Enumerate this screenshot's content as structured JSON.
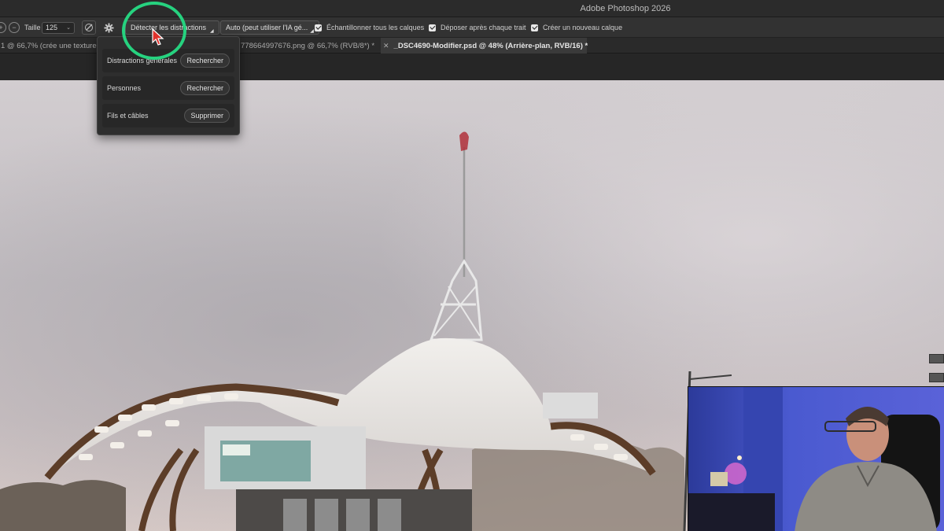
{
  "app": {
    "title": "Adobe Photoshop 2026"
  },
  "options_bar": {
    "size_label": "Taille",
    "size_value": "125",
    "detect_button": "Détecter les distractions",
    "mode_select": "Auto (peut utiliser l'IA gé...",
    "checkboxes": [
      {
        "label": "Échantillonner tous les calques",
        "checked": true
      },
      {
        "label": "Déposer après chaque trait",
        "checked": true
      },
      {
        "label": "Créer un nouveau calque",
        "checked": true
      }
    ]
  },
  "tabs": [
    {
      "label": "1 @ 66,7% (crée une texture",
      "active": false
    },
    {
      "label": "778664997676.png @ 66,7% (RVB/8*) *",
      "active": false
    },
    {
      "label": "_DSC4690-Modifier.psd @ 48% (Arrière-plan, RVB/16) *",
      "active": true
    }
  ],
  "detect_menu": {
    "items": [
      {
        "label": "Distractions générales",
        "action": "Rechercher"
      },
      {
        "label": "Personnes",
        "action": "Rechercher"
      },
      {
        "label": "Fils et câbles",
        "action": "Supprimer"
      }
    ]
  },
  "colors": {
    "highlight": "#26d27f",
    "cursor": "#e0322c",
    "sky": "#cfcacc",
    "canopy": "#e9e6e3",
    "timber": "#6a4a33"
  },
  "icons": {
    "options_left": [
      "brush-minus-icon",
      "brush-plus-icon"
    ],
    "pressure": "stylus-pressure-icon",
    "settings": "gear-icon",
    "tab_close": "close-icon",
    "pointer": "cursor-arrow-icon"
  }
}
